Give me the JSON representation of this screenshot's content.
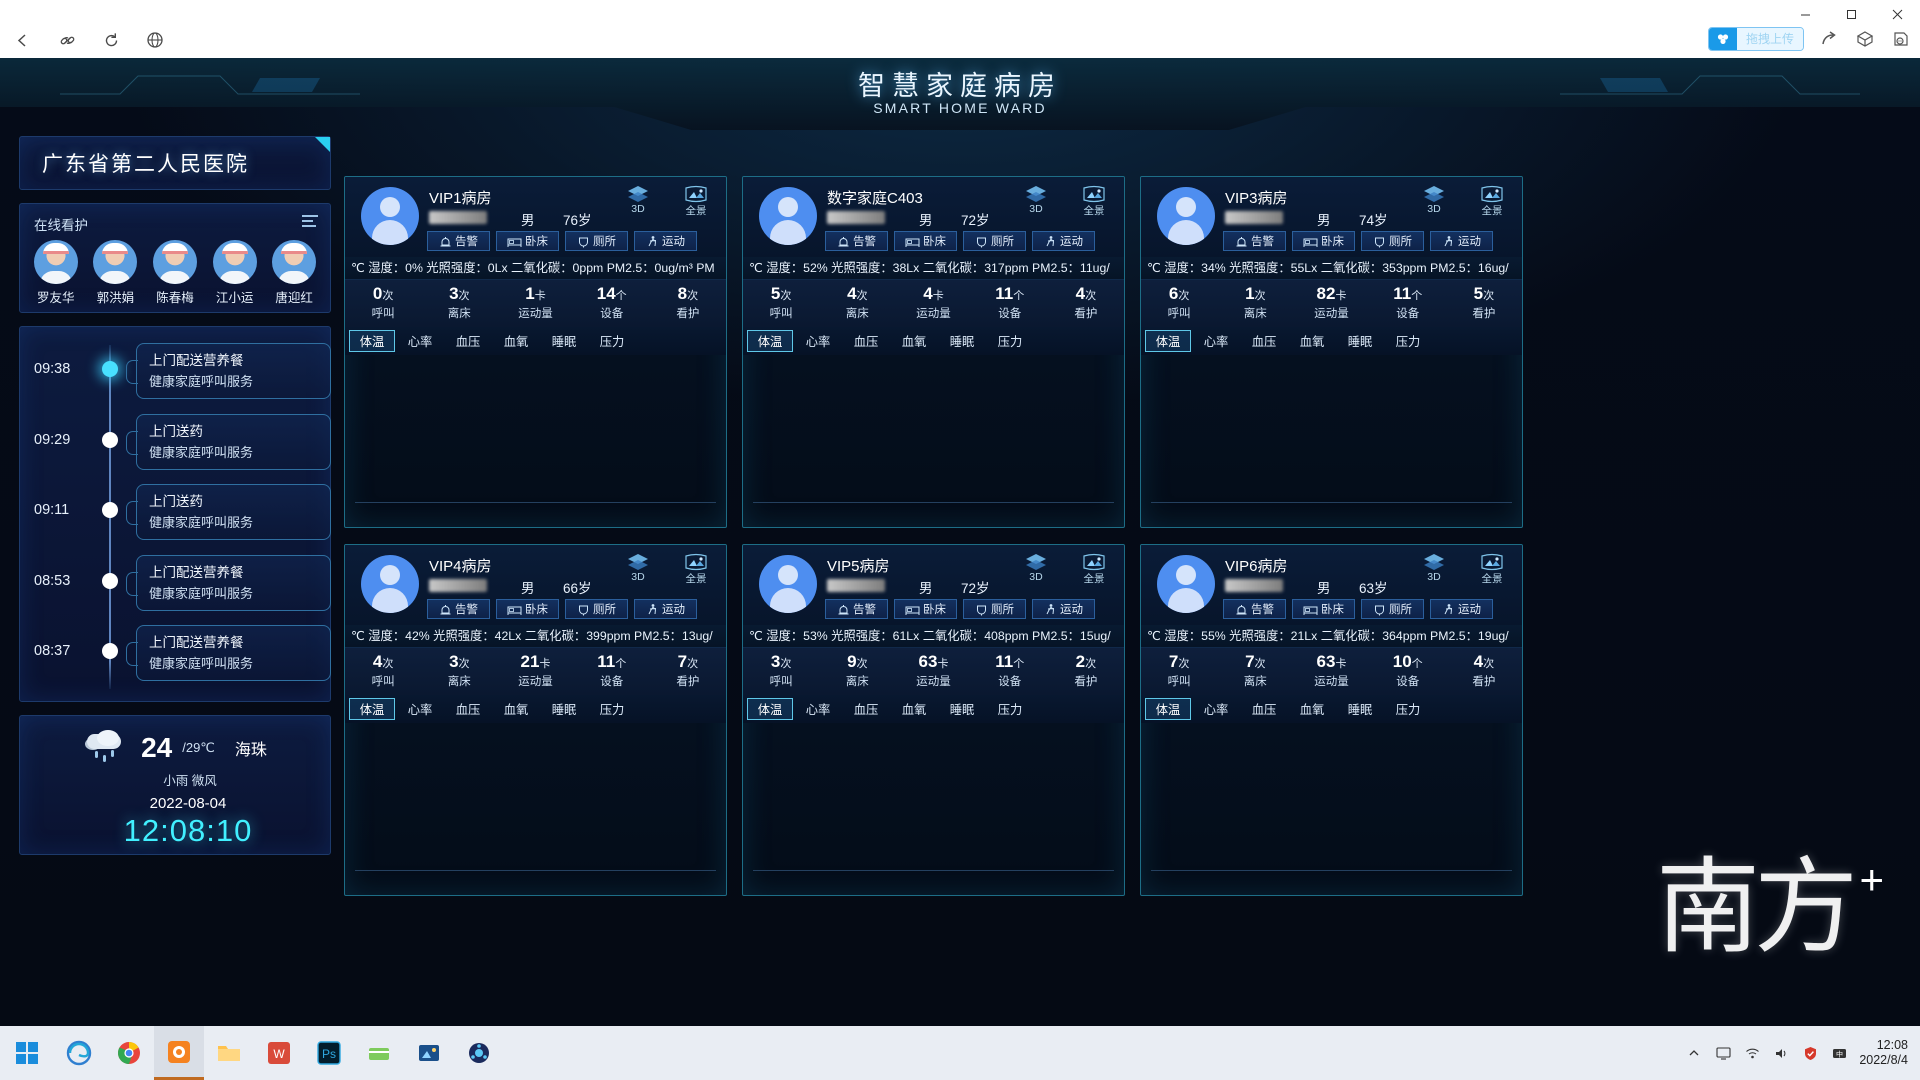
{
  "browser": {
    "back_icon": "back-arrow-icon",
    "link_icon": "link-icon",
    "reload_icon": "reload-icon",
    "globe_icon": "globe-icon",
    "upload_label": "拖拽上传",
    "share_icon": "share-icon",
    "box_icon": "box-icon",
    "note_icon": "note-icon",
    "minimize": "─",
    "maximize": "❐",
    "close": "✕"
  },
  "header": {
    "title": "智慧家庭病房",
    "subtitle": "SMART HOME WARD"
  },
  "sidebar": {
    "hospital_name": "广东省第二人民医院",
    "care": {
      "title": "在线看护",
      "nurses": [
        {
          "name": "罗友华"
        },
        {
          "name": "郭洪娟"
        },
        {
          "name": "陈春梅"
        },
        {
          "name": "江小运"
        },
        {
          "name": "唐迎红"
        }
      ]
    },
    "timeline": [
      {
        "time": "09:38",
        "line1": "上门配送营养餐",
        "line2": "健康家庭呼叫服务",
        "active": true
      },
      {
        "time": "09:29",
        "line1": "上门送药",
        "line2": "健康家庭呼叫服务",
        "active": false
      },
      {
        "time": "09:11",
        "line1": "上门送药",
        "line2": "健康家庭呼叫服务",
        "active": false
      },
      {
        "time": "08:53",
        "line1": "上门配送营养餐",
        "line2": "健康家庭呼叫服务",
        "active": false
      },
      {
        "time": "08:37",
        "line1": "上门配送营养餐",
        "line2": "健康家庭呼叫服务",
        "active": false
      }
    ],
    "weather": {
      "temp": "24",
      "temp_high": "/29℃",
      "location": "海珠",
      "description": "小雨 微风",
      "date": "2022-08-04",
      "clock": "12:08:10",
      "icon": "rain-cloud-icon"
    }
  },
  "ward_common": {
    "view_buttons": [
      {
        "label": "3D",
        "icon": "cube-3d-icon"
      },
      {
        "label": "全景",
        "icon": "panorama-icon"
      }
    ],
    "action_buttons": [
      {
        "label": "告警",
        "icon": "alarm-icon"
      },
      {
        "label": "卧床",
        "icon": "bed-icon"
      },
      {
        "label": "厕所",
        "icon": "toilet-icon"
      },
      {
        "label": "运动",
        "icon": "motion-icon"
      }
    ],
    "stat_labels": [
      "呼叫",
      "离床",
      "运动量",
      "设备",
      "看护"
    ],
    "stat_units": [
      "次",
      "次",
      "卡",
      "个",
      "次"
    ],
    "tabs": [
      "体温",
      "心率",
      "血压",
      "血氧",
      "睡眠",
      "压力"
    ],
    "active_tab": "体温",
    "env_prefix": "℃ 湿度：",
    "env_light": " 光照强度：",
    "env_co2": " 二氧化碳：",
    "env_pm": " PM2.5："
  },
  "wards": [
    {
      "room": "VIP1病房",
      "sex": "男",
      "age": "76岁",
      "env": "℃ 湿度：0% 光照强度：0Lx 二氧化碳：0ppm PM2.5：0ug/m³ PM",
      "humidity": "0%",
      "light": "0Lx",
      "co2": "0ppm",
      "pm25": "0ug/m³",
      "stats": [
        "0",
        "3",
        "1",
        "14",
        "8"
      ]
    },
    {
      "room": "数字家庭C403",
      "sex": "男",
      "age": "72岁",
      "env": "℃ 湿度：52% 光照强度：38Lx 二氧化碳：317ppm PM2.5：11ug/",
      "humidity": "52%",
      "light": "38Lx",
      "co2": "317ppm",
      "pm25": "11ug/",
      "stats": [
        "5",
        "4",
        "4",
        "11",
        "4"
      ]
    },
    {
      "room": "VIP3病房",
      "sex": "男",
      "age": "74岁",
      "env": "℃ 湿度：34% 光照强度：55Lx 二氧化碳：353ppm PM2.5：16ug/",
      "humidity": "34%",
      "light": "55Lx",
      "co2": "353ppm",
      "pm25": "16ug/",
      "stats": [
        "6",
        "1",
        "82",
        "11",
        "5"
      ]
    },
    {
      "room": "VIP4病房",
      "sex": "男",
      "age": "66岁",
      "env": "℃ 湿度：42% 光照强度：42Lx 二氧化碳：399ppm PM2.5：13ug/",
      "humidity": "42%",
      "light": "42Lx",
      "co2": "399ppm",
      "pm25": "13ug/",
      "stats": [
        "4",
        "3",
        "21",
        "11",
        "7"
      ]
    },
    {
      "room": "VIP5病房",
      "sex": "男",
      "age": "72岁",
      "env": "℃ 湿度：53% 光照强度：61Lx 二氧化碳：408ppm PM2.5：15ug/",
      "humidity": "53%",
      "light": "61Lx",
      "co2": "408ppm",
      "pm25": "15ug/",
      "stats": [
        "3",
        "9",
        "63",
        "11",
        "2"
      ]
    },
    {
      "room": "VIP6病房",
      "sex": "男",
      "age": "63岁",
      "env": "℃ 湿度：55% 光照强度：21Lx 二氧化碳：364ppm PM2.5：19ug/",
      "humidity": "55%",
      "light": "21Lx",
      "co2": "364ppm",
      "pm25": "19ug/",
      "stats": [
        "7",
        "7",
        "63",
        "10",
        "4"
      ]
    }
  ],
  "watermark": {
    "text": "南方",
    "plus": "+"
  },
  "taskbar": {
    "start_icon": "windows-start-icon",
    "apps": [
      {
        "name": "edge-icon"
      },
      {
        "name": "chrome-icon"
      },
      {
        "name": "app-orange-icon"
      },
      {
        "name": "file-explorer-icon"
      },
      {
        "name": "wps-icon"
      },
      {
        "name": "photoshop-icon"
      },
      {
        "name": "editor-icon"
      },
      {
        "name": "image-app-icon"
      },
      {
        "name": "blue-app-icon"
      }
    ],
    "tray": [
      "chevron-up-icon",
      "monitor-icon",
      "network-icon",
      "volume-icon",
      "shield-icon",
      "input-icon"
    ],
    "time": "12:08",
    "date": "2022/8/4"
  }
}
